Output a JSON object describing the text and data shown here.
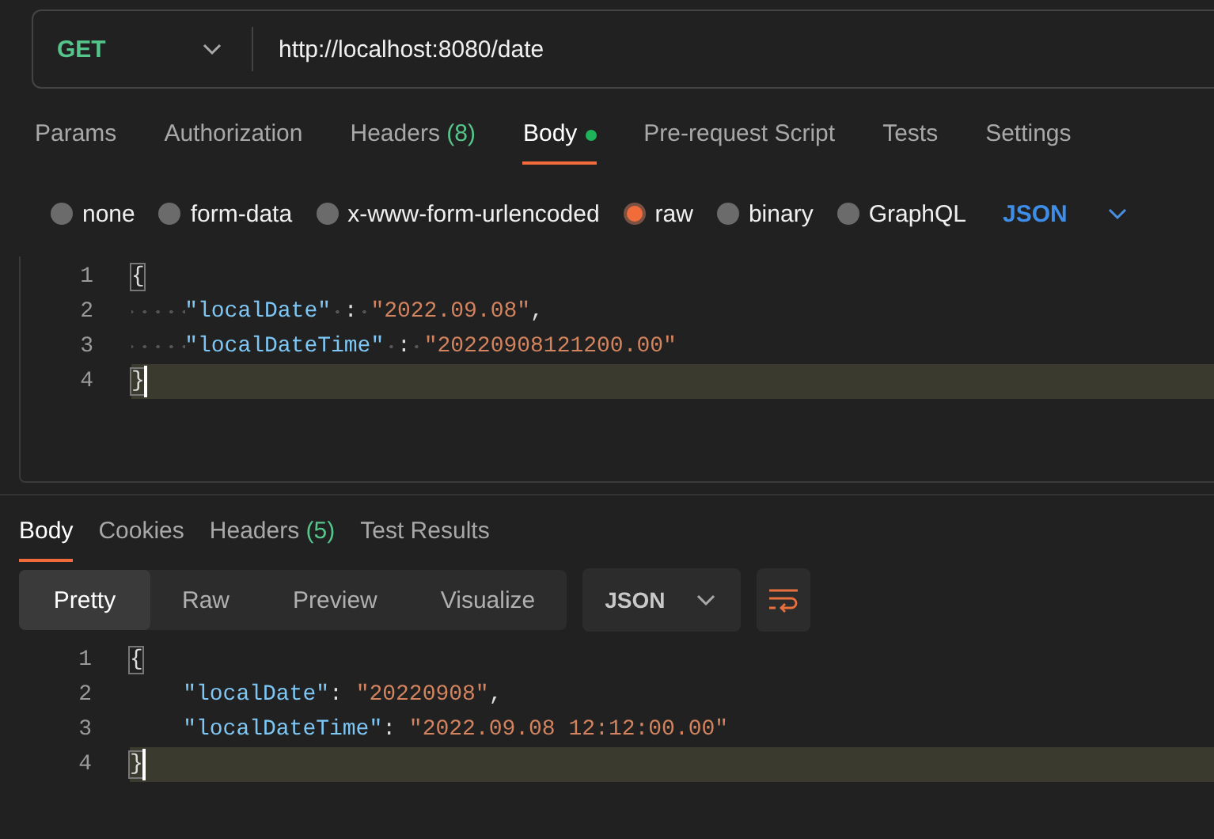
{
  "request": {
    "method": "GET",
    "url": "http://localhost:8080/date"
  },
  "request_tabs": [
    {
      "label": "Params",
      "selected": false
    },
    {
      "label": "Authorization",
      "selected": false
    },
    {
      "label": "Headers",
      "count": "(8)",
      "selected": false
    },
    {
      "label": "Body",
      "selected": true,
      "modified": true
    },
    {
      "label": "Pre-request Script",
      "selected": false
    },
    {
      "label": "Tests",
      "selected": false
    },
    {
      "label": "Settings",
      "selected": false
    }
  ],
  "body_types": [
    {
      "label": "none",
      "selected": false
    },
    {
      "label": "form-data",
      "selected": false
    },
    {
      "label": "x-www-form-urlencoded",
      "selected": false
    },
    {
      "label": "raw",
      "selected": true
    },
    {
      "label": "binary",
      "selected": false
    },
    {
      "label": "GraphQL",
      "selected": false
    }
  ],
  "body_format": "JSON",
  "request_editor": {
    "whitespace_visible": true,
    "lines": [
      {
        "number": "1",
        "current": false,
        "indented": false,
        "tokens": [
          {
            "kind": "brace",
            "text": "{"
          }
        ]
      },
      {
        "number": "2",
        "current": false,
        "indented": true,
        "tokens": [
          {
            "kind": "key",
            "text": "\"localDate\""
          },
          {
            "kind": "punct",
            "text": ":",
            "space_before": true
          },
          {
            "kind": "string",
            "text": "\"2022.09.08\"",
            "space_before": true
          },
          {
            "kind": "punct",
            "text": ","
          }
        ]
      },
      {
        "number": "3",
        "current": false,
        "indented": true,
        "tokens": [
          {
            "kind": "key",
            "text": "\"localDateTime\""
          },
          {
            "kind": "punct",
            "text": ":",
            "space_before": true
          },
          {
            "kind": "string",
            "text": "\"20220908121200.00\"",
            "space_before": true
          }
        ]
      },
      {
        "number": "4",
        "current": true,
        "indented": false,
        "tokens": [
          {
            "kind": "brace",
            "text": "}"
          }
        ]
      }
    ]
  },
  "response_tabs": [
    {
      "label": "Body",
      "selected": true
    },
    {
      "label": "Cookies",
      "selected": false
    },
    {
      "label": "Headers",
      "count": "(5)",
      "selected": false
    },
    {
      "label": "Test Results",
      "selected": false
    }
  ],
  "view_modes": [
    {
      "label": "Pretty",
      "selected": true
    },
    {
      "label": "Raw",
      "selected": false
    },
    {
      "label": "Preview",
      "selected": false
    },
    {
      "label": "Visualize",
      "selected": false
    }
  ],
  "response_format": "JSON",
  "response_editor": {
    "lines": [
      {
        "number": "1",
        "current": false,
        "indented": false,
        "tokens": [
          {
            "kind": "brace",
            "text": "{"
          }
        ]
      },
      {
        "number": "2",
        "current": false,
        "indented": true,
        "tokens": [
          {
            "kind": "key",
            "text": "\"localDate\""
          },
          {
            "kind": "punct",
            "text": ":"
          },
          {
            "kind": "string",
            "text": "\"20220908\"",
            "space_before": true
          },
          {
            "kind": "punct",
            "text": ","
          }
        ]
      },
      {
        "number": "3",
        "current": false,
        "indented": true,
        "tokens": [
          {
            "kind": "key",
            "text": "\"localDateTime\""
          },
          {
            "kind": "punct",
            "text": ":"
          },
          {
            "kind": "string",
            "text": "\"2022.09.08 12:12:00.00\"",
            "space_before": true
          }
        ]
      },
      {
        "number": "4",
        "current": true,
        "indented": false,
        "tokens": [
          {
            "kind": "brace",
            "text": "}"
          }
        ]
      }
    ]
  }
}
